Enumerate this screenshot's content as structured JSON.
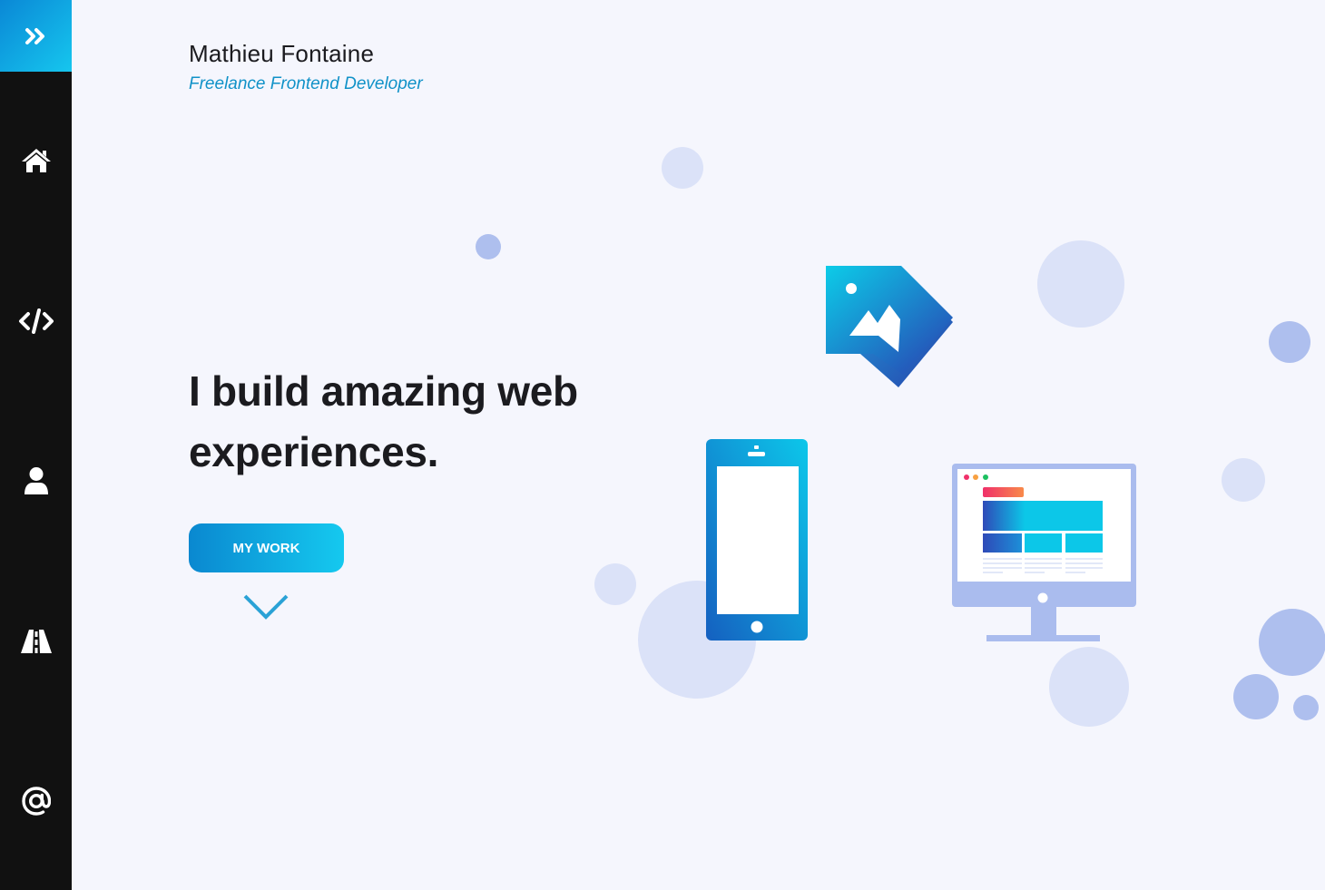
{
  "header": {
    "name": "Mathieu Fontaine",
    "role": "Freelance Frontend Developer"
  },
  "hero": {
    "headline": "I build amazing web experiences.",
    "cta_label": "MY WORK"
  },
  "sidebar": {
    "toggle_icon": "double-chevron-right-icon",
    "items": [
      {
        "icon": "home-icon"
      },
      {
        "icon": "code-icon"
      },
      {
        "icon": "user-icon"
      },
      {
        "icon": "road-icon"
      },
      {
        "icon": "at-icon"
      }
    ]
  },
  "colors": {
    "accent_start": "#0a88d0",
    "accent_end": "#15c9ef",
    "sidebar_bg": "#111111",
    "page_bg": "#f5f6fd",
    "role_text": "#1192c8"
  }
}
